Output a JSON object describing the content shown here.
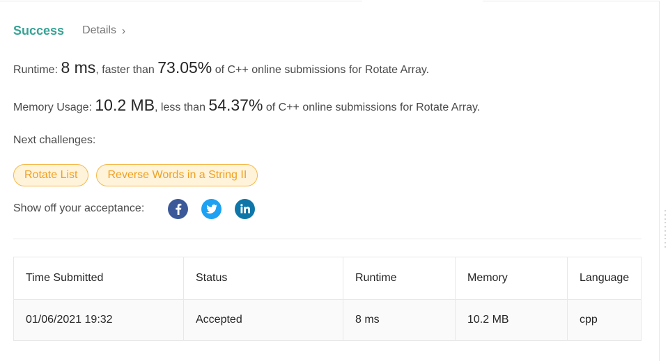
{
  "result": {
    "status_label": "Success",
    "details_label": "Details"
  },
  "runtime": {
    "label": "Runtime: ",
    "value": "8 ms",
    "faster_text": ", faster than ",
    "percent": "73.05%",
    "suffix": " of C++ online submissions for Rotate Array."
  },
  "memory": {
    "label": "Memory Usage: ",
    "value": "10.2 MB",
    "less_text": ", less than ",
    "percent": "54.37%",
    "suffix": " of C++ online submissions for Rotate Array."
  },
  "next_challenges": {
    "label": "Next challenges:",
    "items": [
      "Rotate List",
      "Reverse Words in a String II"
    ]
  },
  "share": {
    "label": "Show off your acceptance:",
    "icons": [
      "facebook-icon",
      "twitter-icon",
      "linkedin-icon"
    ]
  },
  "submissions": {
    "headers": [
      "Time Submitted",
      "Status",
      "Runtime",
      "Memory",
      "Language"
    ],
    "rows": [
      [
        "01/06/2021 19:32",
        "Accepted",
        "8 ms",
        "10.2 MB",
        "cpp"
      ]
    ]
  },
  "colors": {
    "success": "#38a395",
    "chip_border": "#f5b94b",
    "chip_bg": "#fff3da",
    "chip_text": "#f0a020",
    "facebook": "#3b5998",
    "twitter": "#1da1f2",
    "linkedin": "#0e76a8"
  }
}
